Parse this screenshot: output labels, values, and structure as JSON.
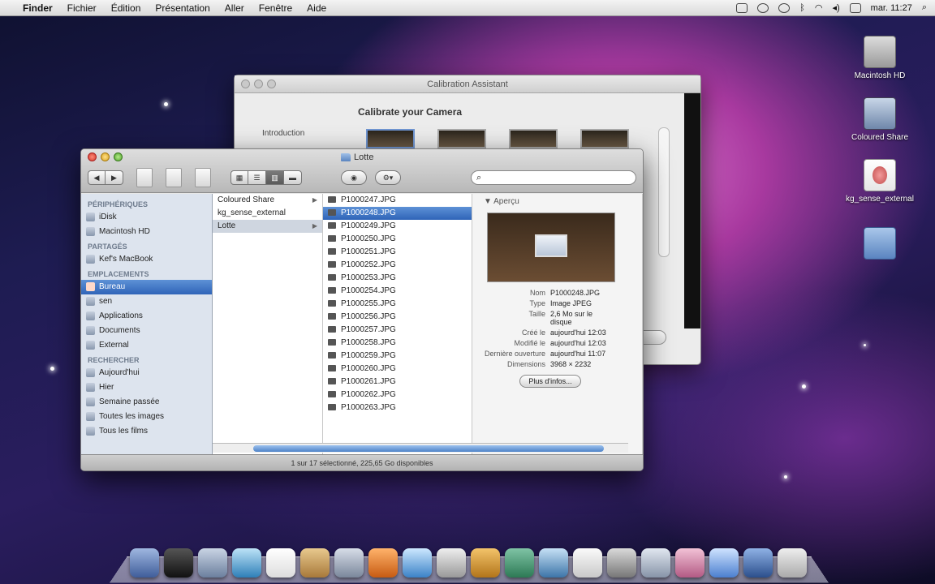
{
  "menubar": {
    "apple": "",
    "items": [
      "Finder",
      "Fichier",
      "Édition",
      "Présentation",
      "Aller",
      "Fenêtre",
      "Aide"
    ],
    "clock": "mar. 11:27"
  },
  "desktop": {
    "icons": [
      {
        "label": "Macintosh HD"
      },
      {
        "label": "Coloured Share"
      },
      {
        "label": "kg_sense_external"
      },
      {
        "label": ""
      }
    ]
  },
  "calibration_window": {
    "title": "Calibration Assistant",
    "heading": "Calibrate your Camera",
    "side_item": "Introduction"
  },
  "finder": {
    "title": "Lotte",
    "search": {
      "placeholder": "",
      "value": ""
    },
    "sidebar": {
      "sections": [
        {
          "header": "Périphériques",
          "items": [
            {
              "label": "iDisk"
            },
            {
              "label": "Macintosh HD"
            }
          ]
        },
        {
          "header": "Partagés",
          "items": [
            {
              "label": "Kef's MacBook"
            }
          ]
        },
        {
          "header": "Emplacements",
          "items": [
            {
              "label": "Bureau",
              "selected": true
            },
            {
              "label": "sen"
            },
            {
              "label": "Applications"
            },
            {
              "label": "Documents"
            },
            {
              "label": "External"
            }
          ]
        },
        {
          "header": "Rechercher",
          "items": [
            {
              "label": "Aujourd'hui"
            },
            {
              "label": "Hier"
            },
            {
              "label": "Semaine passée"
            },
            {
              "label": "Toutes les images"
            },
            {
              "label": "Tous les films"
            }
          ]
        }
      ]
    },
    "column2": [
      {
        "label": "Coloured Share",
        "arrow": "▶"
      },
      {
        "label": "kg_sense_external",
        "arrow": ""
      },
      {
        "label": "Lotte",
        "arrow": "▶",
        "state": "sel"
      }
    ],
    "column3": [
      "P1000247.JPG",
      "P1000248.JPG",
      "P1000249.JPG",
      "P1000250.JPG",
      "P1000251.JPG",
      "P1000252.JPG",
      "P1000253.JPG",
      "P1000254.JPG",
      "P1000255.JPG",
      "P1000256.JPG",
      "P1000257.JPG",
      "P1000258.JPG",
      "P1000259.JPG",
      "P1000260.JPG",
      "P1000261.JPG",
      "P1000262.JPG",
      "P1000263.JPG"
    ],
    "column3_selected_index": 1,
    "preview": {
      "header": "▼ Aperçu",
      "meta": [
        {
          "k": "Nom",
          "v": "P1000248.JPG"
        },
        {
          "k": "Type",
          "v": "Image JPEG"
        },
        {
          "k": "Taille",
          "v": "2,6 Mo sur le disque"
        },
        {
          "k": "Créé le",
          "v": "aujourd'hui 12:03"
        },
        {
          "k": "Modifié le",
          "v": "aujourd'hui 12:03"
        },
        {
          "k": "Dernière ouverture",
          "v": "aujourd'hui 11:07"
        },
        {
          "k": "Dimensions",
          "v": "3968 × 2232"
        }
      ],
      "more_button": "Plus d'infos..."
    },
    "status": "1 sur 17 sélectionné, 225,65 Go disponibles"
  },
  "colors": {
    "selection": "#2f64b8",
    "sidebar_bg": "#dde4ee"
  }
}
